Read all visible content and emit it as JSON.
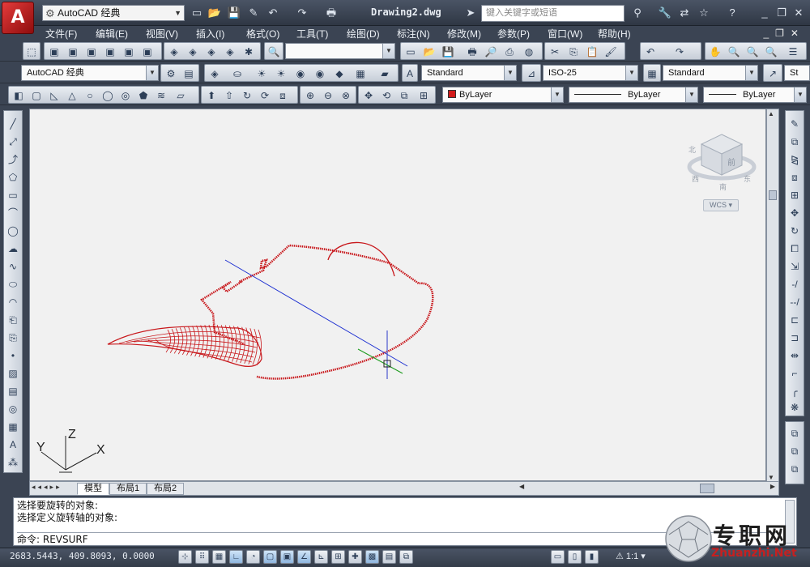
{
  "app": {
    "logo_letter": "A",
    "workspace": "AutoCAD 经典",
    "document_title": "Drawing2.dwg",
    "search_placeholder": "键入关键字或短语"
  },
  "menu": [
    "文件(F)",
    "编辑(E)",
    "视图(V)",
    "插入(I)",
    "格式(O)",
    "工具(T)",
    "绘图(D)",
    "标注(N)",
    "修改(M)",
    "参数(P)",
    "窗口(W)",
    "帮助(H)"
  ],
  "toolbars": {
    "workspace_select": "AutoCAD 经典",
    "text_style": "Standard",
    "dim_style": "ISO-25",
    "table_style": "Standard",
    "multileader_style": "St",
    "layer_color": "ByLayer",
    "linetype": "ByLayer",
    "lineweight": "ByLayer",
    "layer_color_swatch": "#d11a1a"
  },
  "viewport": {
    "viewcube_face": "前",
    "viewcube_labels": [
      "北",
      "西",
      "东",
      "南"
    ],
    "wcs_label": "WCS",
    "ucs_axes": {
      "x": "X",
      "y": "Y",
      "z": "Z"
    },
    "drawing_colors": {
      "profile": "#c8171b",
      "axis": "#1c2fd1",
      "cursor": "#2a38c9",
      "cursor_green": "#1a9a1a"
    }
  },
  "tabs": [
    "模型",
    "布局1",
    "布局2"
  ],
  "command": {
    "history": [
      "选择要旋转的对象:",
      "选择定义旋转轴的对象:"
    ],
    "prompt": "命令: REVSURF"
  },
  "status": {
    "coordinates": "2683.5443, 409.8093, 0.0000",
    "annotation_scale": "1:1"
  },
  "watermark": {
    "cn": "专职网",
    "en": "Zhuanzhi.Net"
  }
}
